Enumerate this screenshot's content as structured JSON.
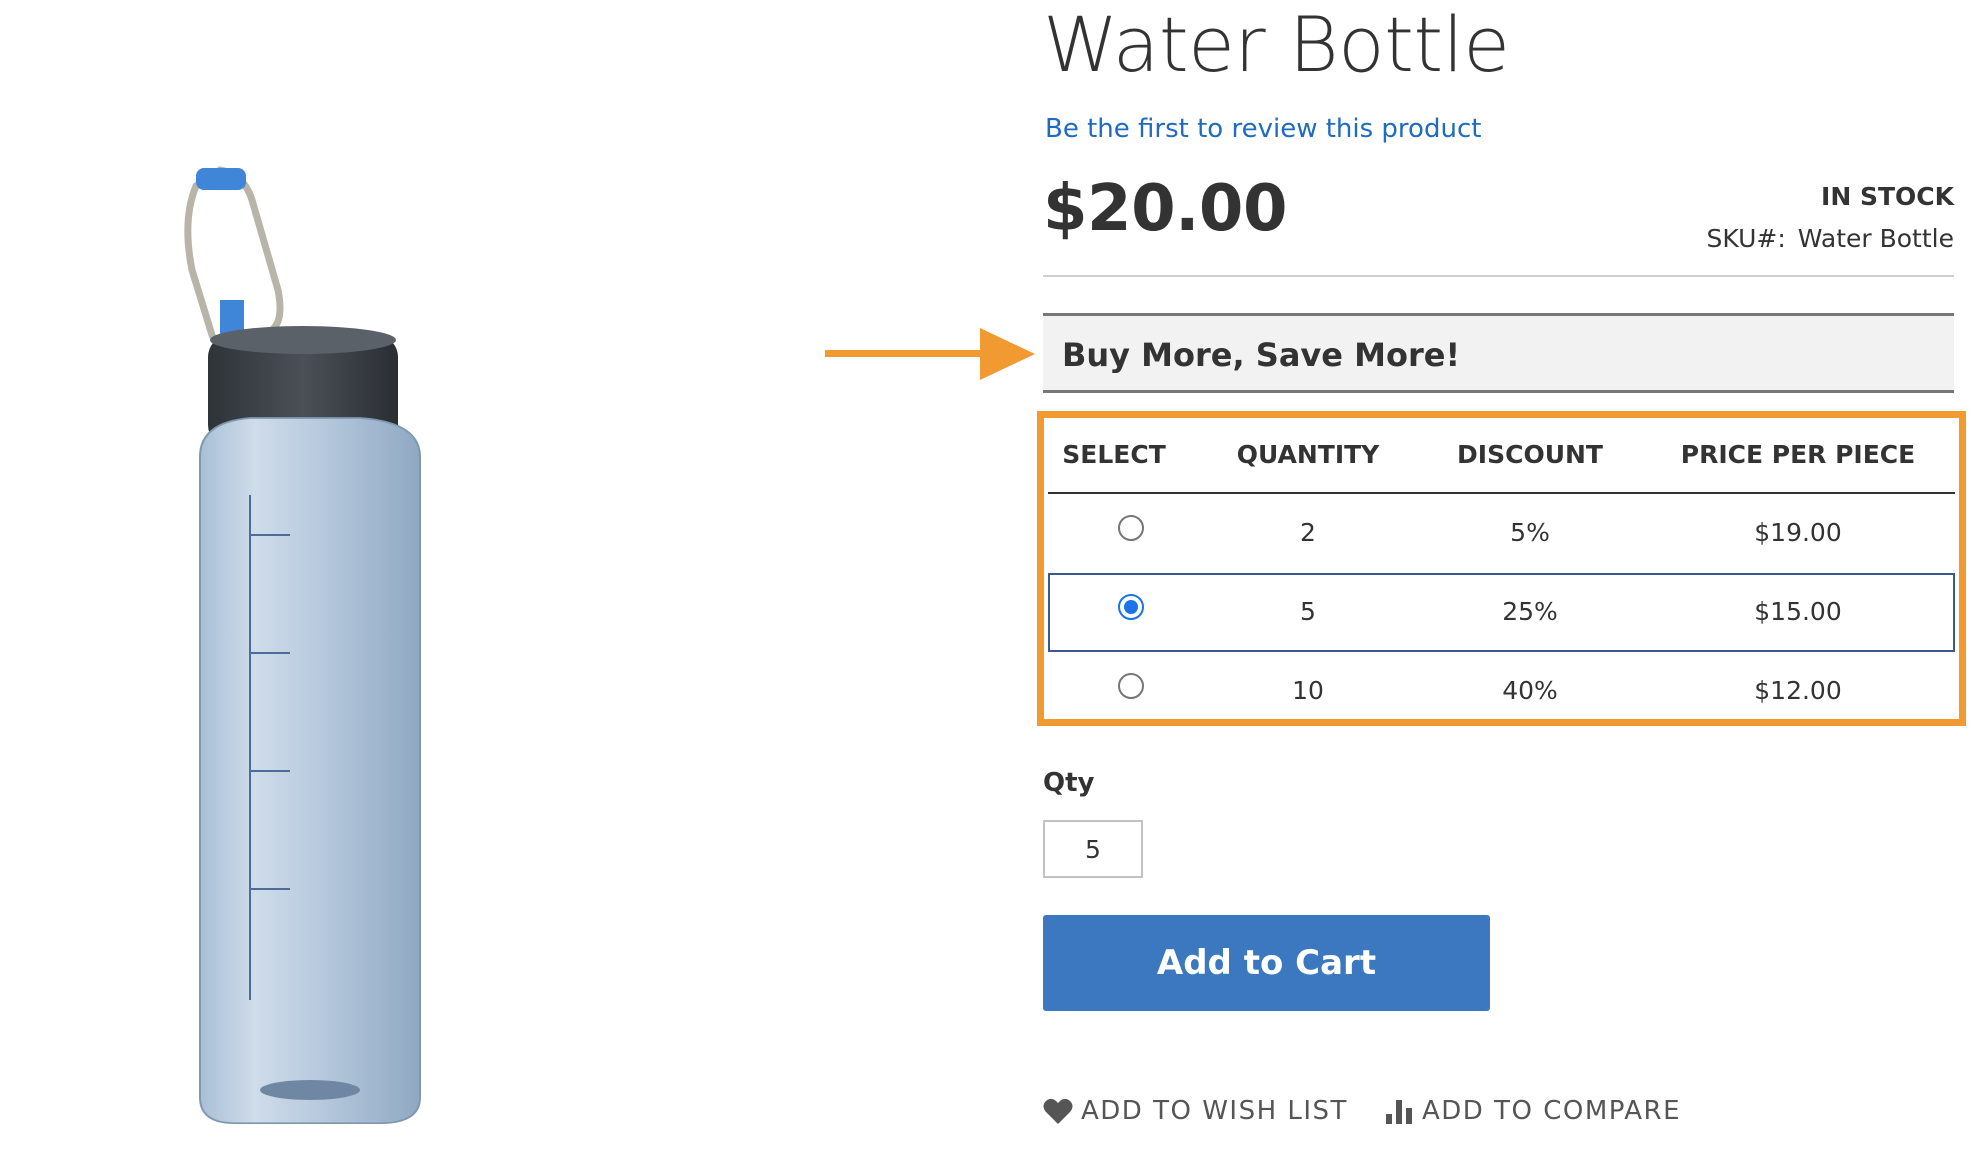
{
  "product": {
    "title": "Water Bottle",
    "review_link": "Be the first to review this product",
    "price": "$20.00",
    "stock": "IN STOCK",
    "sku_label": "SKU#:",
    "sku_value": "Water Bottle"
  },
  "promo": {
    "heading": "Buy More, Save More!"
  },
  "tier_table": {
    "headers": [
      "SELECT",
      "QUANTITY",
      "DISCOUNT",
      "PRICE PER PIECE"
    ],
    "rows": [
      {
        "quantity": "2",
        "discount": "5%",
        "price": "$19.00",
        "selected": false
      },
      {
        "quantity": "5",
        "discount": "25%",
        "price": "$15.00",
        "selected": true
      },
      {
        "quantity": "10",
        "discount": "40%",
        "price": "$12.00",
        "selected": false
      }
    ]
  },
  "qty": {
    "label": "Qty",
    "value": "5"
  },
  "actions": {
    "add_to_cart": "Add to Cart",
    "wish_list": "ADD TO WISH LIST",
    "compare": "ADD TO COMPARE"
  },
  "colors": {
    "accent_orange": "#f29a32",
    "button_blue": "#3b78c0",
    "link_blue": "#1f6bbf"
  },
  "icons": {
    "wish": "heart-icon",
    "compare": "bar-chart-icon",
    "arrow": "arrow-right-icon"
  }
}
